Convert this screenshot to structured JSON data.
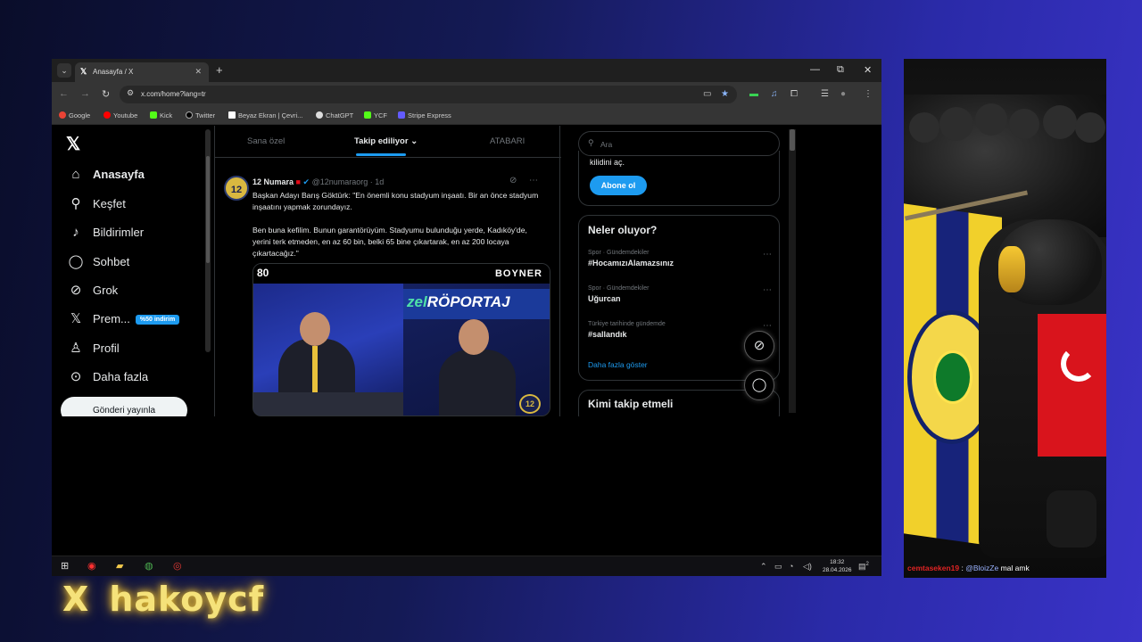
{
  "overlay": {
    "x": "X",
    "handle": "hakoycf"
  },
  "browser": {
    "tab_title": "Anasayfa / X",
    "url": "x.com/home?lang=tr",
    "bookmarks": [
      "Google",
      "Youtube",
      "Kick",
      "Twitter",
      "Beyaz Ekran | Çevri...",
      "ChatGPT",
      "YCF",
      "Stripe Express"
    ]
  },
  "x": {
    "nav": [
      {
        "label": "Anasayfa",
        "icon": "home-icon"
      },
      {
        "label": "Keşfet",
        "icon": "search-icon"
      },
      {
        "label": "Bildirimler",
        "icon": "bell-icon"
      },
      {
        "label": "Sohbet",
        "icon": "chat-icon"
      },
      {
        "label": "Grok",
        "icon": "grok-icon"
      },
      {
        "label": "Prem...",
        "icon": "x-icon"
      },
      {
        "label": "Profil",
        "icon": "user-icon"
      },
      {
        "label": "Daha fazla",
        "icon": "more-icon"
      }
    ],
    "premium_badge": "%50 indirim",
    "post_button": "Gönderi yayınla",
    "feed_tabs": [
      "Sana özel",
      "Takip ediliyor",
      "ATABARI"
    ],
    "tweet": {
      "name": "12 Numara",
      "handle": "@12numaraorg · 1d",
      "avatar": "12",
      "paragraph1": "Başkan Adayı Barış Göktürk: \"En önemli konu stadyum inşaatı. Bir an önce stadyum inşaatını yapmak zorundayız.",
      "paragraph2": "Ben buna kefilim. Bunun garantörüyüm. Stadyumu bulunduğu yerde, Kadıköy'de, yerini terk etmeden, en az 60 bin, belki 65 bine çıkartarak, en az 200 locaya çıkartacağız.\"",
      "media_logo": "80",
      "media_brand": "BOYNER",
      "media_banner_em": "zel",
      "media_banner": "RÖPORTAJ",
      "media_badge": "12"
    },
    "right": {
      "search_placeholder": "Ara",
      "unlock_text": "kilidini aç.",
      "subscribe_label": "Abone ol",
      "trends_title": "Neler oluyor?",
      "trends": [
        {
          "category": "Spor · Gündemdekiler",
          "name": "#HocamızıAlamazsınız"
        },
        {
          "category": "Spor · Gündemdekiler",
          "name": "Uğurcan"
        },
        {
          "category": "Türkiye tarihinde gündemde",
          "name": "#sallandık"
        }
      ],
      "show_more": "Daha fazla göster",
      "who_to_follow": "Kimi takip etmeli"
    }
  },
  "taskbar": {
    "time": "18:32",
    "date": "28.04.2026",
    "notif_count": "2"
  },
  "chat": {
    "user": "cemtaseken19",
    "colon": " : ",
    "mention": "@BloizZe",
    "message": " mal amk"
  }
}
